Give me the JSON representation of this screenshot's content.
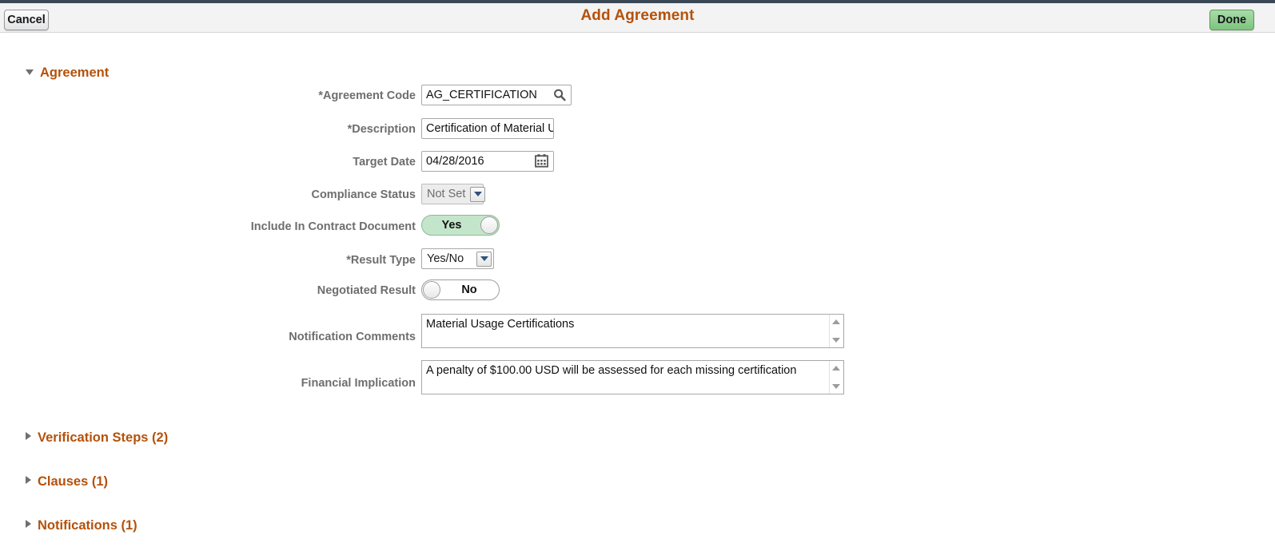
{
  "header": {
    "title": "Add Agreement",
    "cancel_label": "Cancel",
    "done_label": "Done"
  },
  "sections": {
    "agreement": {
      "label": "Agreement",
      "expanded": true
    },
    "verification_steps": {
      "label": "Verification Steps (2)",
      "expanded": false
    },
    "clauses": {
      "label": "Clauses (1)",
      "expanded": false
    },
    "notifications": {
      "label": "Notifications (1)",
      "expanded": false
    }
  },
  "form": {
    "agreement_code": {
      "label": "*Agreement Code",
      "value": "AG_CERTIFICATION",
      "lookup_icon": "search-icon"
    },
    "description": {
      "label": "*Description",
      "value": "Certification of Material U"
    },
    "target_date": {
      "label": "Target Date",
      "value": "04/28/2016",
      "picker_icon": "calendar-icon"
    },
    "compliance_status": {
      "label": "Compliance Status",
      "value": "Not Set",
      "disabled": true
    },
    "include_in_contract_document": {
      "label": "Include In Contract Document",
      "value": "Yes",
      "state": "on"
    },
    "result_type": {
      "label": "*Result Type",
      "value": "Yes/No"
    },
    "negotiated_result": {
      "label": "Negotiated Result",
      "value": "No",
      "state": "off"
    },
    "notification_comments": {
      "label": "Notification Comments",
      "value": "Material Usage Certifications"
    },
    "financial_implication": {
      "label": "Financial Implication",
      "value": "A penalty of $100.00 USD will be assessed for each missing certification"
    }
  },
  "colors": {
    "accent": "#b5510a",
    "label": "#6e6e6e",
    "header_bg": "#f3f3f3",
    "header_border": "#3a4755",
    "toggle_on": "#c3e6ca",
    "done_button": "#8cc98c"
  }
}
